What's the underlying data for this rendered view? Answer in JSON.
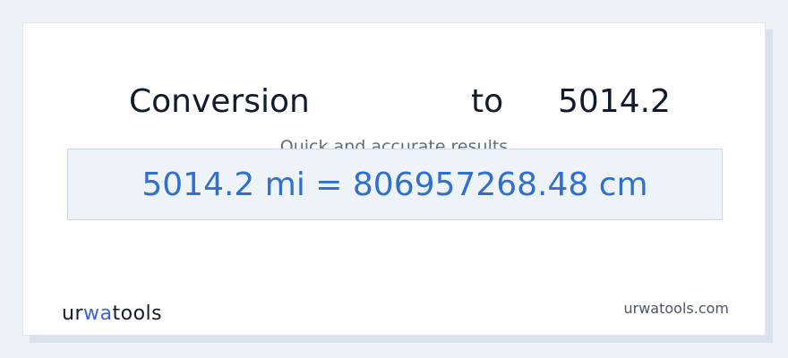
{
  "headline": {
    "left_word": "Conversion",
    "middle_word": "to",
    "right_value": "5014.2"
  },
  "subtitle": "Quick and accurate results",
  "result": {
    "text": "5014.2 mi = 806957268.48 cm"
  },
  "brand": {
    "logo_prefix": "ur",
    "logo_accent": "wa",
    "logo_suffix": "tools",
    "logo_accent_color": "#3b63d8"
  },
  "footer": {
    "site_url": "urwatools.com"
  },
  "colors": {
    "result_text": "#2f6fd0",
    "headline_text": "#111a2e"
  }
}
